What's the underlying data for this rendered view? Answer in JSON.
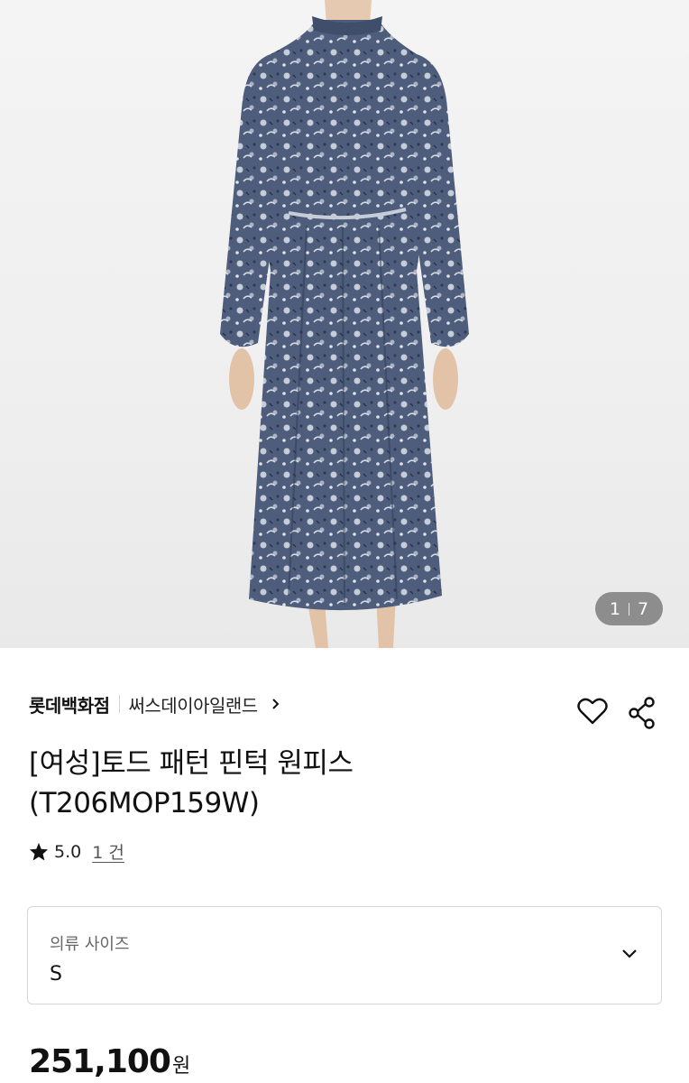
{
  "gallery": {
    "current": "1",
    "total": "7",
    "image_desc_icon": "dress-photo"
  },
  "product": {
    "brand": "롯데백화점",
    "sub_brand": "써스데이아일랜드",
    "title_line1": "[여성]토드 패턴 핀턱 원피스",
    "title_line2": "(T206MOP159W)",
    "rating": "5.0",
    "review_count": "1 건"
  },
  "options": {
    "size_label": "의류 사이즈",
    "size_value": "S"
  },
  "price": {
    "amount": "251,100",
    "unit": "원"
  },
  "colors": {
    "dress_navy": "#4a5a78",
    "dress_light": "#c9cfd9",
    "mannequin": "#e6c9b1"
  }
}
